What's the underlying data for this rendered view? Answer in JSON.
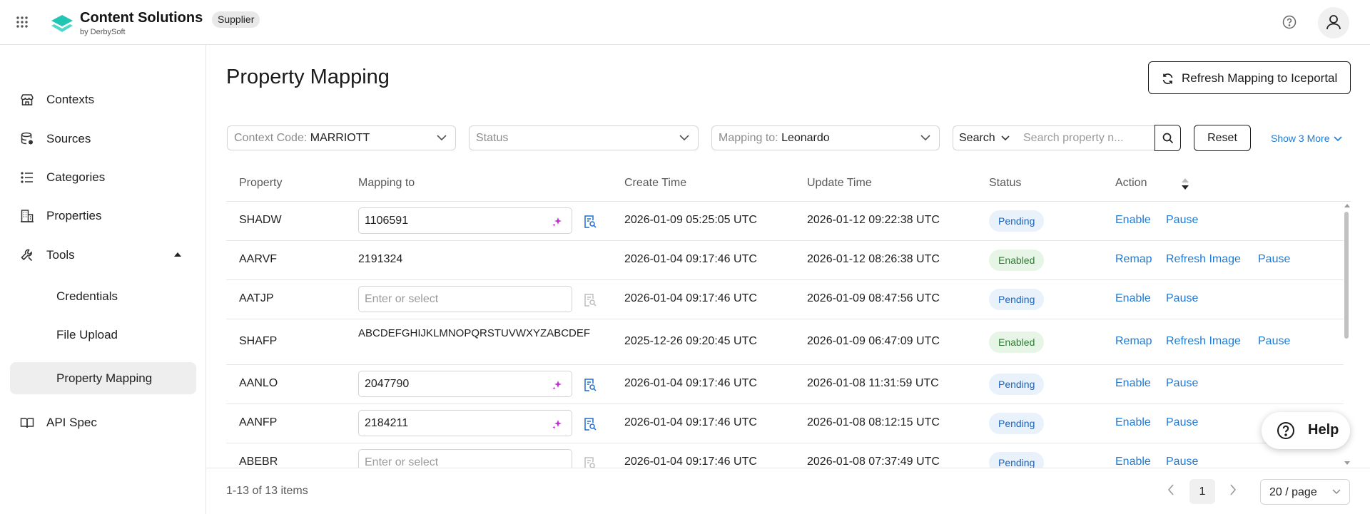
{
  "app": {
    "name": "Content Solutions",
    "sub": "by DerbySoft",
    "role": "Supplier"
  },
  "sidebar": {
    "items": [
      {
        "label": "Contexts",
        "icon": "storefront-icon"
      },
      {
        "label": "Sources",
        "icon": "database-icon"
      },
      {
        "label": "Categories",
        "icon": "list-icon"
      },
      {
        "label": "Properties",
        "icon": "building-icon"
      },
      {
        "label": "Tools",
        "icon": "wrench-icon",
        "expanded": true
      }
    ],
    "sub_items": [
      {
        "label": "Credentials"
      },
      {
        "label": "File Upload"
      },
      {
        "label": "Property Mapping",
        "active": true
      }
    ],
    "api_spec": {
      "label": "API Spec",
      "icon": "book-icon"
    }
  },
  "page": {
    "title": "Property Mapping",
    "refresh_button": "Refresh Mapping to Iceportal"
  },
  "filters": {
    "context": {
      "label": "Context Code:",
      "value": "MARRIOTT"
    },
    "status": {
      "placeholder": "Status"
    },
    "mapping_to": {
      "label": "Mapping to:",
      "value": "Leonardo"
    },
    "search_type": "Search",
    "search_placeholder": "Search property n...",
    "reset": "Reset",
    "show_more": "Show 3 More"
  },
  "table": {
    "headers": [
      "Property",
      "Mapping to",
      "Create Time",
      "Update Time",
      "Status",
      "Action"
    ],
    "rows": [
      {
        "property": "SHADW",
        "mapping": "1106591",
        "mode": "input",
        "create": "2026-01-09 05:25:05 UTC",
        "update": "2026-01-12 09:22:38 UTC",
        "status": "Pending",
        "actions": [
          "Enable",
          "Pause"
        ]
      },
      {
        "property": "AARVF",
        "mapping": "2191324",
        "mode": "text",
        "create": "2026-01-04 09:17:46 UTC",
        "update": "2026-01-12 08:26:38 UTC",
        "status": "Enabled",
        "actions": [
          "Remap",
          "Refresh Image",
          "Pause"
        ]
      },
      {
        "property": "AATJP",
        "mapping": "",
        "mode": "empty",
        "create": "2026-01-04 09:17:46 UTC",
        "update": "2026-01-09 08:47:56 UTC",
        "status": "Pending",
        "actions": [
          "Enable",
          "Pause"
        ]
      },
      {
        "property": "SHAFP",
        "mapping": "ABCDEFGHIJKLMNOPQRSTUVWXYZABCDEF",
        "mode": "wrap",
        "create": "2025-12-26 09:20:45 UTC",
        "update": "2026-01-09 06:47:09 UTC",
        "status": "Enabled",
        "actions": [
          "Remap",
          "Refresh Image",
          "Pause"
        ]
      },
      {
        "property": "AANLO",
        "mapping": "2047790",
        "mode": "input",
        "create": "2026-01-04 09:17:46 UTC",
        "update": "2026-01-08 11:31:59 UTC",
        "status": "Pending",
        "actions": [
          "Enable",
          "Pause"
        ]
      },
      {
        "property": "AANFP",
        "mapping": "2184211",
        "mode": "input",
        "create": "2026-01-04 09:17:46 UTC",
        "update": "2026-01-08 08:12:15 UTC",
        "status": "Pending",
        "actions": [
          "Enable",
          "Pause"
        ]
      },
      {
        "property": "ABEBR",
        "mapping": "",
        "mode": "empty",
        "create": "2026-01-04 09:17:46 UTC",
        "update": "2026-01-08 07:37:49 UTC",
        "status": "Pending",
        "actions": [
          "Enable",
          "Pause"
        ]
      }
    ],
    "input_placeholder": "Enter or select"
  },
  "footer": {
    "total": "1-13 of 13 items",
    "page": "1",
    "page_size": "20 / page"
  },
  "help": {
    "label": "Help"
  },
  "colors": {
    "link": "#1f7ad6",
    "brand_teal": "#22c4b4",
    "ai_sparkle": "#c52bd8",
    "pending_bg": "#e9f1fb",
    "enabled_bg": "#e6f5e6"
  }
}
